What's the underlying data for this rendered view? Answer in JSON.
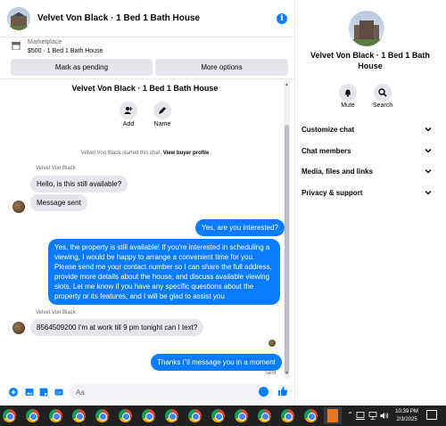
{
  "header": {
    "title": "Velvet Von Black · 1 Bed 1 Bath House"
  },
  "marketplace": {
    "label": "Marketplace",
    "listing": "$500 · 1 Bed 1 Bath House",
    "pending_button": "Mark as pending",
    "more_button": "More options"
  },
  "intro": {
    "title": "Velvet Von Black · 1 Bed 1 Bath House",
    "add_label": "Add",
    "name_label": "Name",
    "started_text": "Velvet Von Black started this chat.",
    "profile_link": "View buyer profile"
  },
  "messages": {
    "sender1": "Velvet Von Black",
    "in1": "Hello, is this still available?",
    "in2": "Message sent",
    "out1": "Yes, are you interested?",
    "out2": "Yes, the property is still available! If you're interested in scheduling a viewing, I would be happy to arrange a convenient time for you. Please send me your contact number so I can share the full address, provide more details about the house, and discuss available viewing slots. Let me know if you have any specific questions about the property or its features, and I will be glad to assist you",
    "sender2": "Velvet Von Black",
    "in3": "8564509200 I'm at work till 9 pm tonight can I text?",
    "out3": "Thanks i''il message you in a moment",
    "sent_status": "Sent"
  },
  "composer": {
    "placeholder": "Aa"
  },
  "info": {
    "title": "Velvet Von Black · 1 Bed 1 Bath House",
    "mute_label": "Mute",
    "search_label": "Search",
    "sections": [
      "Customize chat",
      "Chat members",
      "Media, files and links",
      "Privacy & support"
    ]
  },
  "taskbar": {
    "time": "10:39 PM",
    "date": "2/3/2025"
  },
  "colors": {
    "accent": "#0a7cff",
    "bubble_in": "#e4e6eb",
    "taskbar": "#202020"
  }
}
